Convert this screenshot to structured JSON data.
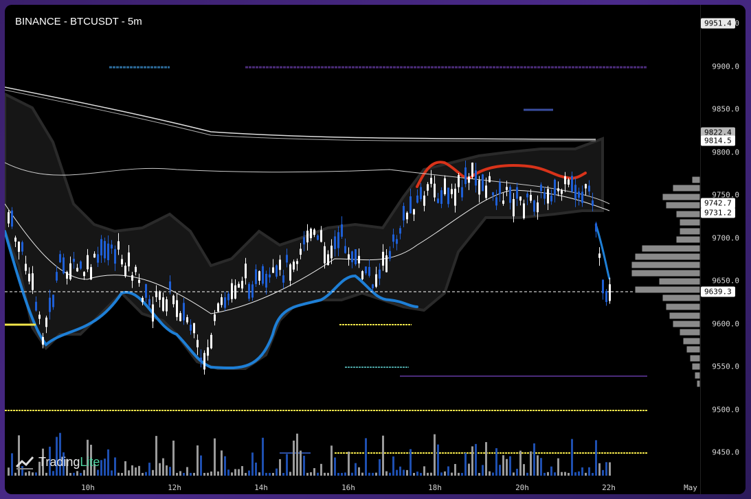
{
  "title": "BINANCE - BTCUSDT - 5m",
  "watermark": {
    "brand": "Trading",
    "suffix": "Lite"
  },
  "price_axis": {
    "ticks": [
      "9950.0",
      "9900.0",
      "9850.0",
      "9800.0",
      "9750.0",
      "9700.0",
      "9650.0",
      "9600.0",
      "9550.0",
      "9500.0",
      "9450.0"
    ],
    "tags": {
      "top": "9951.4",
      "upper_band": "9814.5",
      "hidden": "9822.4",
      "ma1": "9742.7",
      "ma2": "9731.2",
      "last": "9639.3"
    }
  },
  "time_axis": {
    "ticks": [
      "10h",
      "12h",
      "14h",
      "16h",
      "18h",
      "20h",
      "22h",
      "May"
    ]
  },
  "colors": {
    "background": "#000000",
    "bull": "#1e5fd6",
    "bear": "#ffffff",
    "band_low": "#1e7fd6",
    "band_high": "#d8331a",
    "level": "#f2e64a"
  }
}
